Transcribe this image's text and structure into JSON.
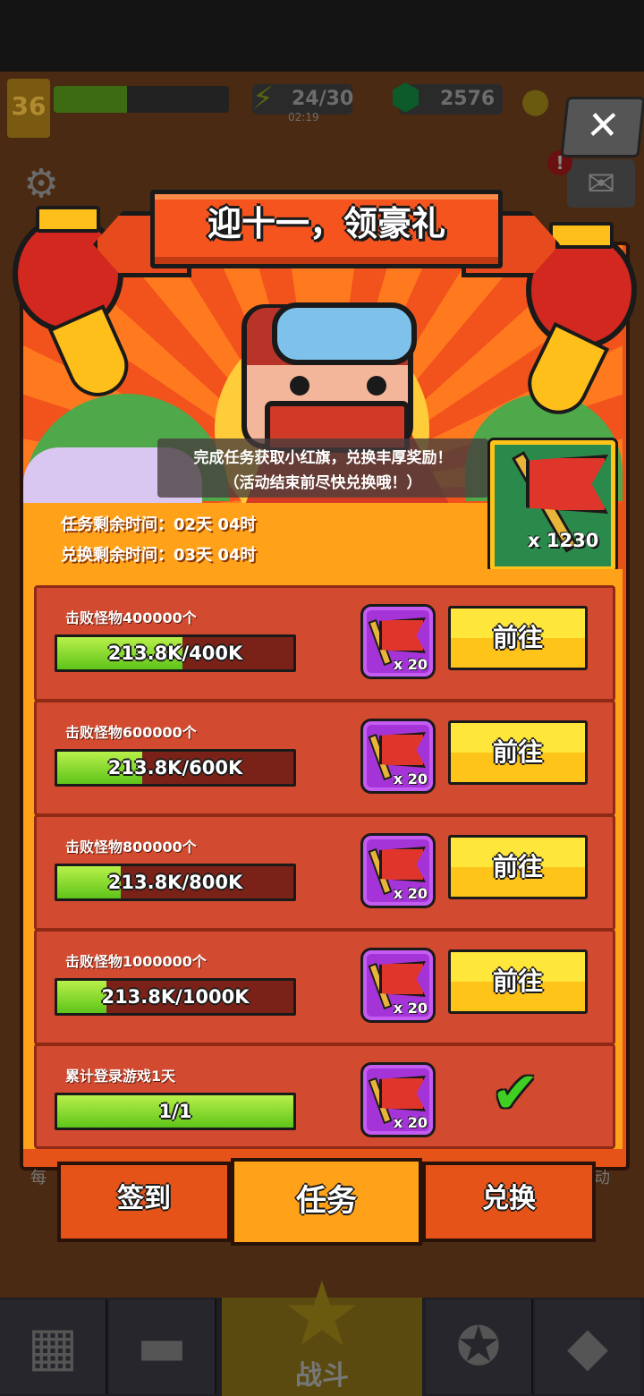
{
  "hud": {
    "level": "36",
    "energy": "24/30",
    "energy_timer": "02:19",
    "gems": "2576"
  },
  "event": {
    "title": "迎十一，领豪礼",
    "desc_line1": "完成任务获取小红旗，兑换丰厚奖励！",
    "desc_line2": "（活动结束前尽快兑换哦！）",
    "flag_count": "x 1230",
    "task_time": "任务剩余时间：02天 04时",
    "exchange_time": "兑换剩余时间：03天 04时"
  },
  "tasks": [
    {
      "title": "击败怪物400000个",
      "progress_text": "213.8K/400K",
      "progress": 0.53,
      "reward": "x 20",
      "action": "前往"
    },
    {
      "title": "击败怪物600000个",
      "progress_text": "213.8K/600K",
      "progress": 0.36,
      "reward": "x 20",
      "action": "前往"
    },
    {
      "title": "击败怪物800000个",
      "progress_text": "213.8K/800K",
      "progress": 0.27,
      "reward": "x 20",
      "action": "前往"
    },
    {
      "title": "击败怪物1000000个",
      "progress_text": "213.8K/1000K",
      "progress": 0.21,
      "reward": "x 20",
      "action": "前往"
    },
    {
      "title": "累计登录游戏1天",
      "progress_text": "1/1",
      "progress": 1.0,
      "reward": "x 20",
      "action": "completed"
    }
  ],
  "tabs": {
    "signin": "签到",
    "task": "任务",
    "exchange": "兑换"
  },
  "under_panel": {
    "left": "每",
    "right": "动"
  },
  "nav": {
    "battle": "战斗"
  },
  "colors": {
    "panel": "#e55319",
    "accent_yellow": "#ffc41a",
    "progress_green": "#5ec41a",
    "reward_purple": "#a534d8"
  }
}
